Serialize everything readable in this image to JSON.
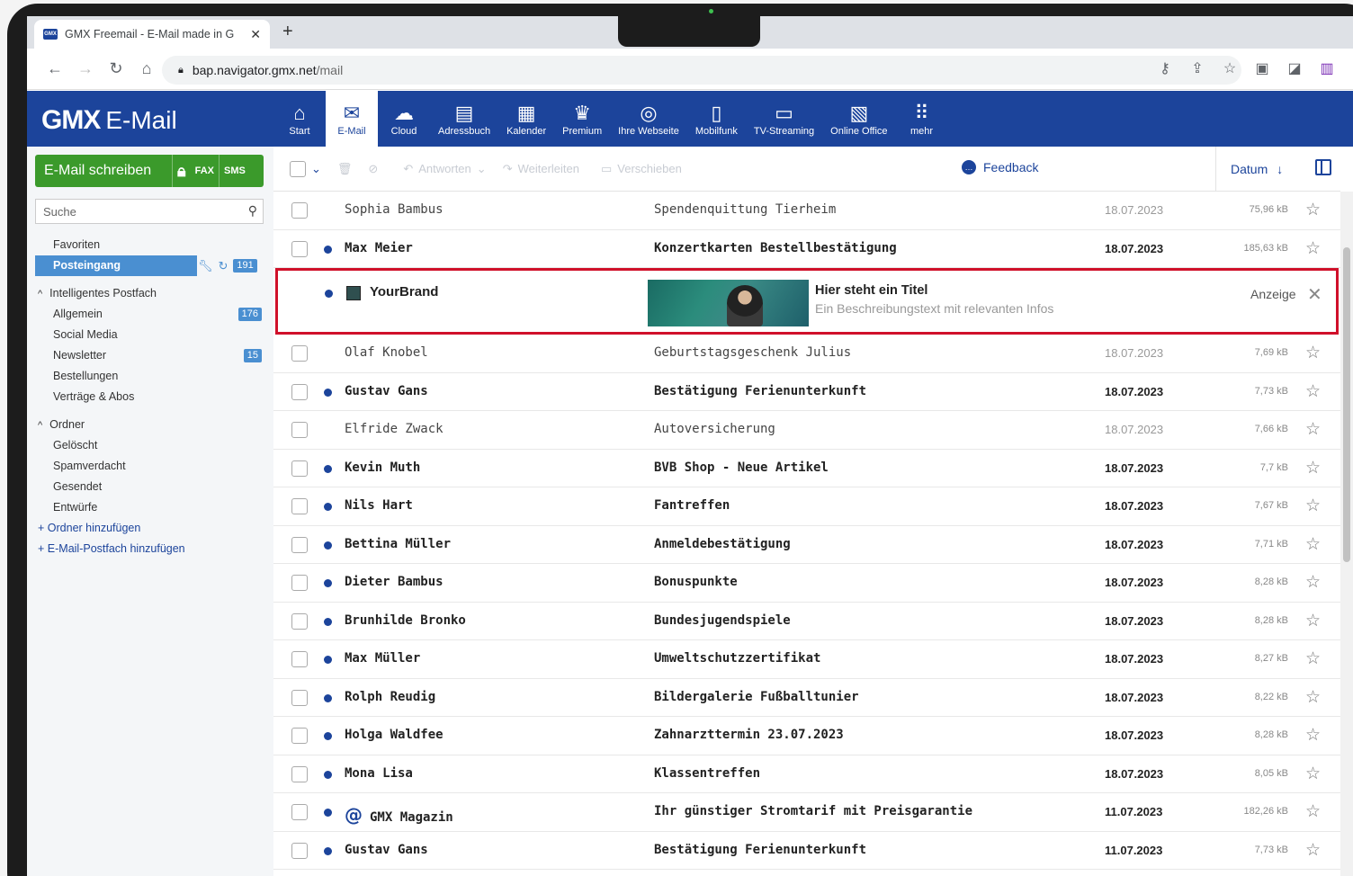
{
  "browser": {
    "tab_title": "GMX Freemail - E-Mail made in G",
    "new_tab": "+",
    "url_host": "bap.navigator.gmx.net",
    "url_path": "/mail"
  },
  "header": {
    "logo_brand": "GMX",
    "logo_product": "E-Mail",
    "nav": [
      {
        "label": "Start",
        "icon": "home-icon",
        "glyph": "⌂"
      },
      {
        "label": "E-Mail",
        "icon": "mail-icon",
        "glyph": "✉"
      },
      {
        "label": "Cloud",
        "icon": "cloud-icon",
        "glyph": "☁"
      },
      {
        "label": "Adressbuch",
        "icon": "addressbook-icon",
        "glyph": "▤"
      },
      {
        "label": "Kalender",
        "icon": "calendar-icon",
        "glyph": "▦"
      },
      {
        "label": "Premium",
        "icon": "crown-icon",
        "glyph": "♛"
      },
      {
        "label": "Ihre Webseite",
        "icon": "globe-icon",
        "glyph": "◎"
      },
      {
        "label": "Mobilfunk",
        "icon": "phone-icon",
        "glyph": "▯"
      },
      {
        "label": "TV-Streaming",
        "icon": "tv-icon",
        "glyph": "▭"
      },
      {
        "label": "Online Office",
        "icon": "office-icon",
        "glyph": "▧"
      },
      {
        "label": "mehr",
        "icon": "grid-icon",
        "glyph": "⠿"
      }
    ],
    "active_nav": "E-Mail"
  },
  "sidebar": {
    "compose_label": "E-Mail schreiben",
    "fax_label": "FAX",
    "sms_label": "SMS",
    "search_placeholder": "Suche",
    "favorites_label": "Favoriten",
    "inbox_label": "Posteingang",
    "inbox_count": "191",
    "smart_group": "Intelligentes Postfach",
    "smart_items": [
      {
        "label": "Allgemein",
        "count": "176"
      },
      {
        "label": "Social Media",
        "count": ""
      },
      {
        "label": "Newsletter",
        "count": "15"
      },
      {
        "label": "Bestellungen",
        "count": ""
      },
      {
        "label": "Verträge & Abos",
        "count": ""
      }
    ],
    "folder_group": "Ordner",
    "folder_items": [
      "Gelöscht",
      "Spamverdacht",
      "Gesendet",
      "Entwürfe"
    ],
    "add_folder": "Ordner hinzufügen",
    "add_mailbox": "E-Mail-Postfach hinzufügen"
  },
  "toolbar": {
    "reply": "Antworten",
    "forward": "Weiterleiten",
    "move": "Verschieben",
    "feedback": "Feedback",
    "sort": "Datum"
  },
  "ad": {
    "brand": "YourBrand",
    "title": "Hier steht ein Titel",
    "description": "Ein Beschreibungstext mit relevanten Infos",
    "label": "Anzeige"
  },
  "emails_before_ad": [
    {
      "from": "Sophia Bambus",
      "subject": "Spendenquittung Tierheim",
      "date": "18.07.2023",
      "size": "75,96 kB",
      "unread": false
    },
    {
      "from": "Max Meier",
      "subject": "Konzertkarten Bestellbestätigung",
      "date": "18.07.2023",
      "size": "185,63 kB",
      "unread": true
    }
  ],
  "emails_after_ad": [
    {
      "from": "Olaf Knobel",
      "subject": "Geburtstagsgeschenk Julius",
      "date": "18.07.2023",
      "size": "7,69 kB",
      "unread": false
    },
    {
      "from": "Gustav Gans",
      "subject": "Bestätigung Ferienunterkunft",
      "date": "18.07.2023",
      "size": "7,73 kB",
      "unread": true
    },
    {
      "from": "Elfride Zwack",
      "subject": "Autoversicherung",
      "date": "18.07.2023",
      "size": "7,66 kB",
      "unread": false
    },
    {
      "from": "Kevin Muth",
      "subject": "BVB Shop - Neue Artikel",
      "date": "18.07.2023",
      "size": "7,7 kB",
      "unread": true
    },
    {
      "from": "Nils Hart",
      "subject": "Fantreffen",
      "date": "18.07.2023",
      "size": "7,67 kB",
      "unread": true
    },
    {
      "from": "Bettina Müller",
      "subject": "Anmeldebestätigung",
      "date": "18.07.2023",
      "size": "7,71 kB",
      "unread": true
    },
    {
      "from": "Dieter Bambus",
      "subject": "Bonuspunkte",
      "date": "18.07.2023",
      "size": "8,28 kB",
      "unread": true
    },
    {
      "from": "Brunhilde Bronko",
      "subject": "Bundesjugendspiele",
      "date": "18.07.2023",
      "size": "8,28 kB",
      "unread": true
    },
    {
      "from": "Max Müller",
      "subject": "Umweltschutzzertifikat",
      "date": "18.07.2023",
      "size": "8,27 kB",
      "unread": true
    },
    {
      "from": "Rolph Reudig",
      "subject": "Bildergalerie Fußballtunier",
      "date": "18.07.2023",
      "size": "8,22 kB",
      "unread": true
    },
    {
      "from": "Holga Waldfee",
      "subject": "Zahnarzttermin 23.07.2023",
      "date": "18.07.2023",
      "size": "8,28 kB",
      "unread": true
    },
    {
      "from": "Mona Lisa",
      "subject": "Klassentreffen",
      "date": "18.07.2023",
      "size": "8,05 kB",
      "unread": true
    },
    {
      "from": "GMX Magazin",
      "subject": "Ihr günstiger Stromtarif mit Preisgarantie",
      "date": "11.07.2023",
      "size": "182,26 kB",
      "unread": true,
      "gmx_icon": true
    },
    {
      "from": "Gustav Gans",
      "subject": "Bestätigung Ferienunterkunft",
      "date": "11.07.2023",
      "size": "7,73 kB",
      "unread": true
    }
  ],
  "colors": {
    "brand_blue": "#1c449b",
    "compose_green": "#3b9a2b",
    "ad_border": "#d0102a",
    "active_folder": "#4a8fd1"
  }
}
